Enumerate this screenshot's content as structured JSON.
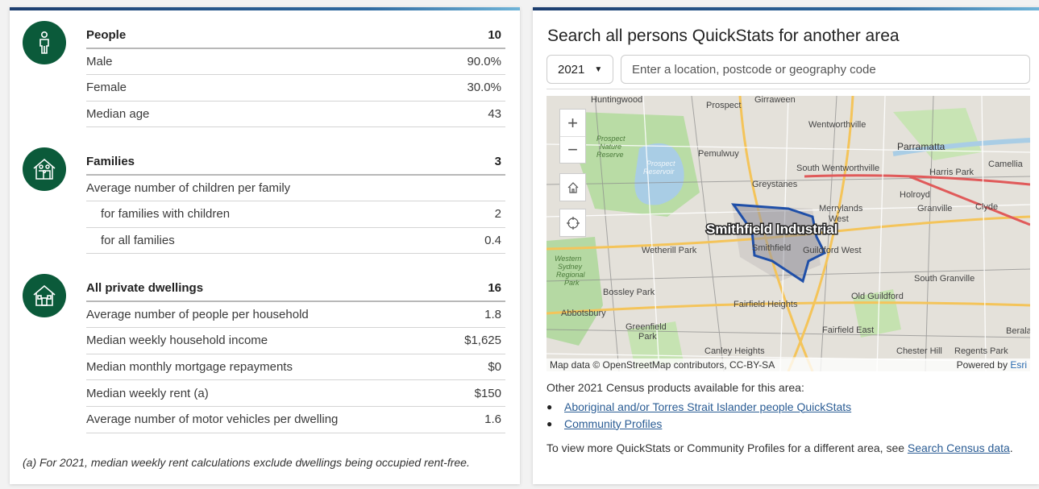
{
  "people": {
    "title": "People",
    "title_value": "10",
    "rows": [
      {
        "label": "Male",
        "value": "90.0%"
      },
      {
        "label": "Female",
        "value": "30.0%"
      },
      {
        "label": "Median age",
        "value": "43"
      }
    ]
  },
  "families": {
    "title": "Families",
    "title_value": "3",
    "rows": [
      {
        "label": "Average number of children per family",
        "value": ""
      },
      {
        "label": "for families with children",
        "value": "2"
      },
      {
        "label": "for all families",
        "value": "0.4"
      }
    ]
  },
  "dwellings": {
    "title": "All private dwellings",
    "title_value": "16",
    "rows": [
      {
        "label": "Average number of people per household",
        "value": "1.8"
      },
      {
        "label": "Median weekly household income",
        "value": "$1,625"
      },
      {
        "label": "Median monthly mortgage repayments",
        "value": "$0"
      },
      {
        "label": "Median weekly rent (a)",
        "value": "$150"
      },
      {
        "label": "Average number of motor vehicles per dwelling",
        "value": "1.6"
      }
    ]
  },
  "footnote": "(a) For 2021, median weekly rent calculations exclude dwellings being occupied rent-free.",
  "icons": {
    "people": "person-icon",
    "families": "family-house-icon",
    "dwellings": "house-icon"
  },
  "colors": {
    "icon_bg": "#0b5a3a",
    "link": "#2a5c94",
    "accent_bar": "#2f6aa0"
  },
  "search": {
    "title": "Search all persons QuickStats for another area",
    "year": "2021",
    "placeholder": "Enter a location, postcode or geography code"
  },
  "map": {
    "area_label": "Smithfield Industrial",
    "places": [
      "Huntingwood",
      "Prospect",
      "Girraween",
      "Wentworthville",
      "Parramatta",
      "Harris Park",
      "Camellia",
      "Prospect Nature Reserve",
      "Prospect Reservoir",
      "Pemulwuy",
      "South Wentworthville",
      "Holroyd",
      "Greystanes",
      "Merrylands",
      "Merrylands West",
      "Granville",
      "Clyde",
      "Smithfield",
      "Guildford West",
      "Wetherill Park",
      "Western Sydney Regional Park",
      "Bossley Park",
      "South Granville",
      "Old Guildford",
      "Fairfield Heights",
      "Abbotsbury",
      "Greenfield Park",
      "Fairfield East",
      "Canley Heights",
      "Chester Hill",
      "Regents Park",
      "Berala"
    ],
    "zoom_in": "+",
    "zoom_out": "−",
    "attribution": "Map data © OpenStreetMap contributors, CC-BY-SA",
    "powered_by": "Powered by",
    "esri": "Esri"
  },
  "products": {
    "intro": "Other 2021 Census products available for this area:",
    "links": [
      "Aboriginal and/or Torres Strait Islander people QuickStats",
      "Community Profiles"
    ]
  },
  "bottom": {
    "text": "To view more QuickStats or Community Profiles for a different area, see ",
    "link": "Search Census data",
    "end": "."
  }
}
